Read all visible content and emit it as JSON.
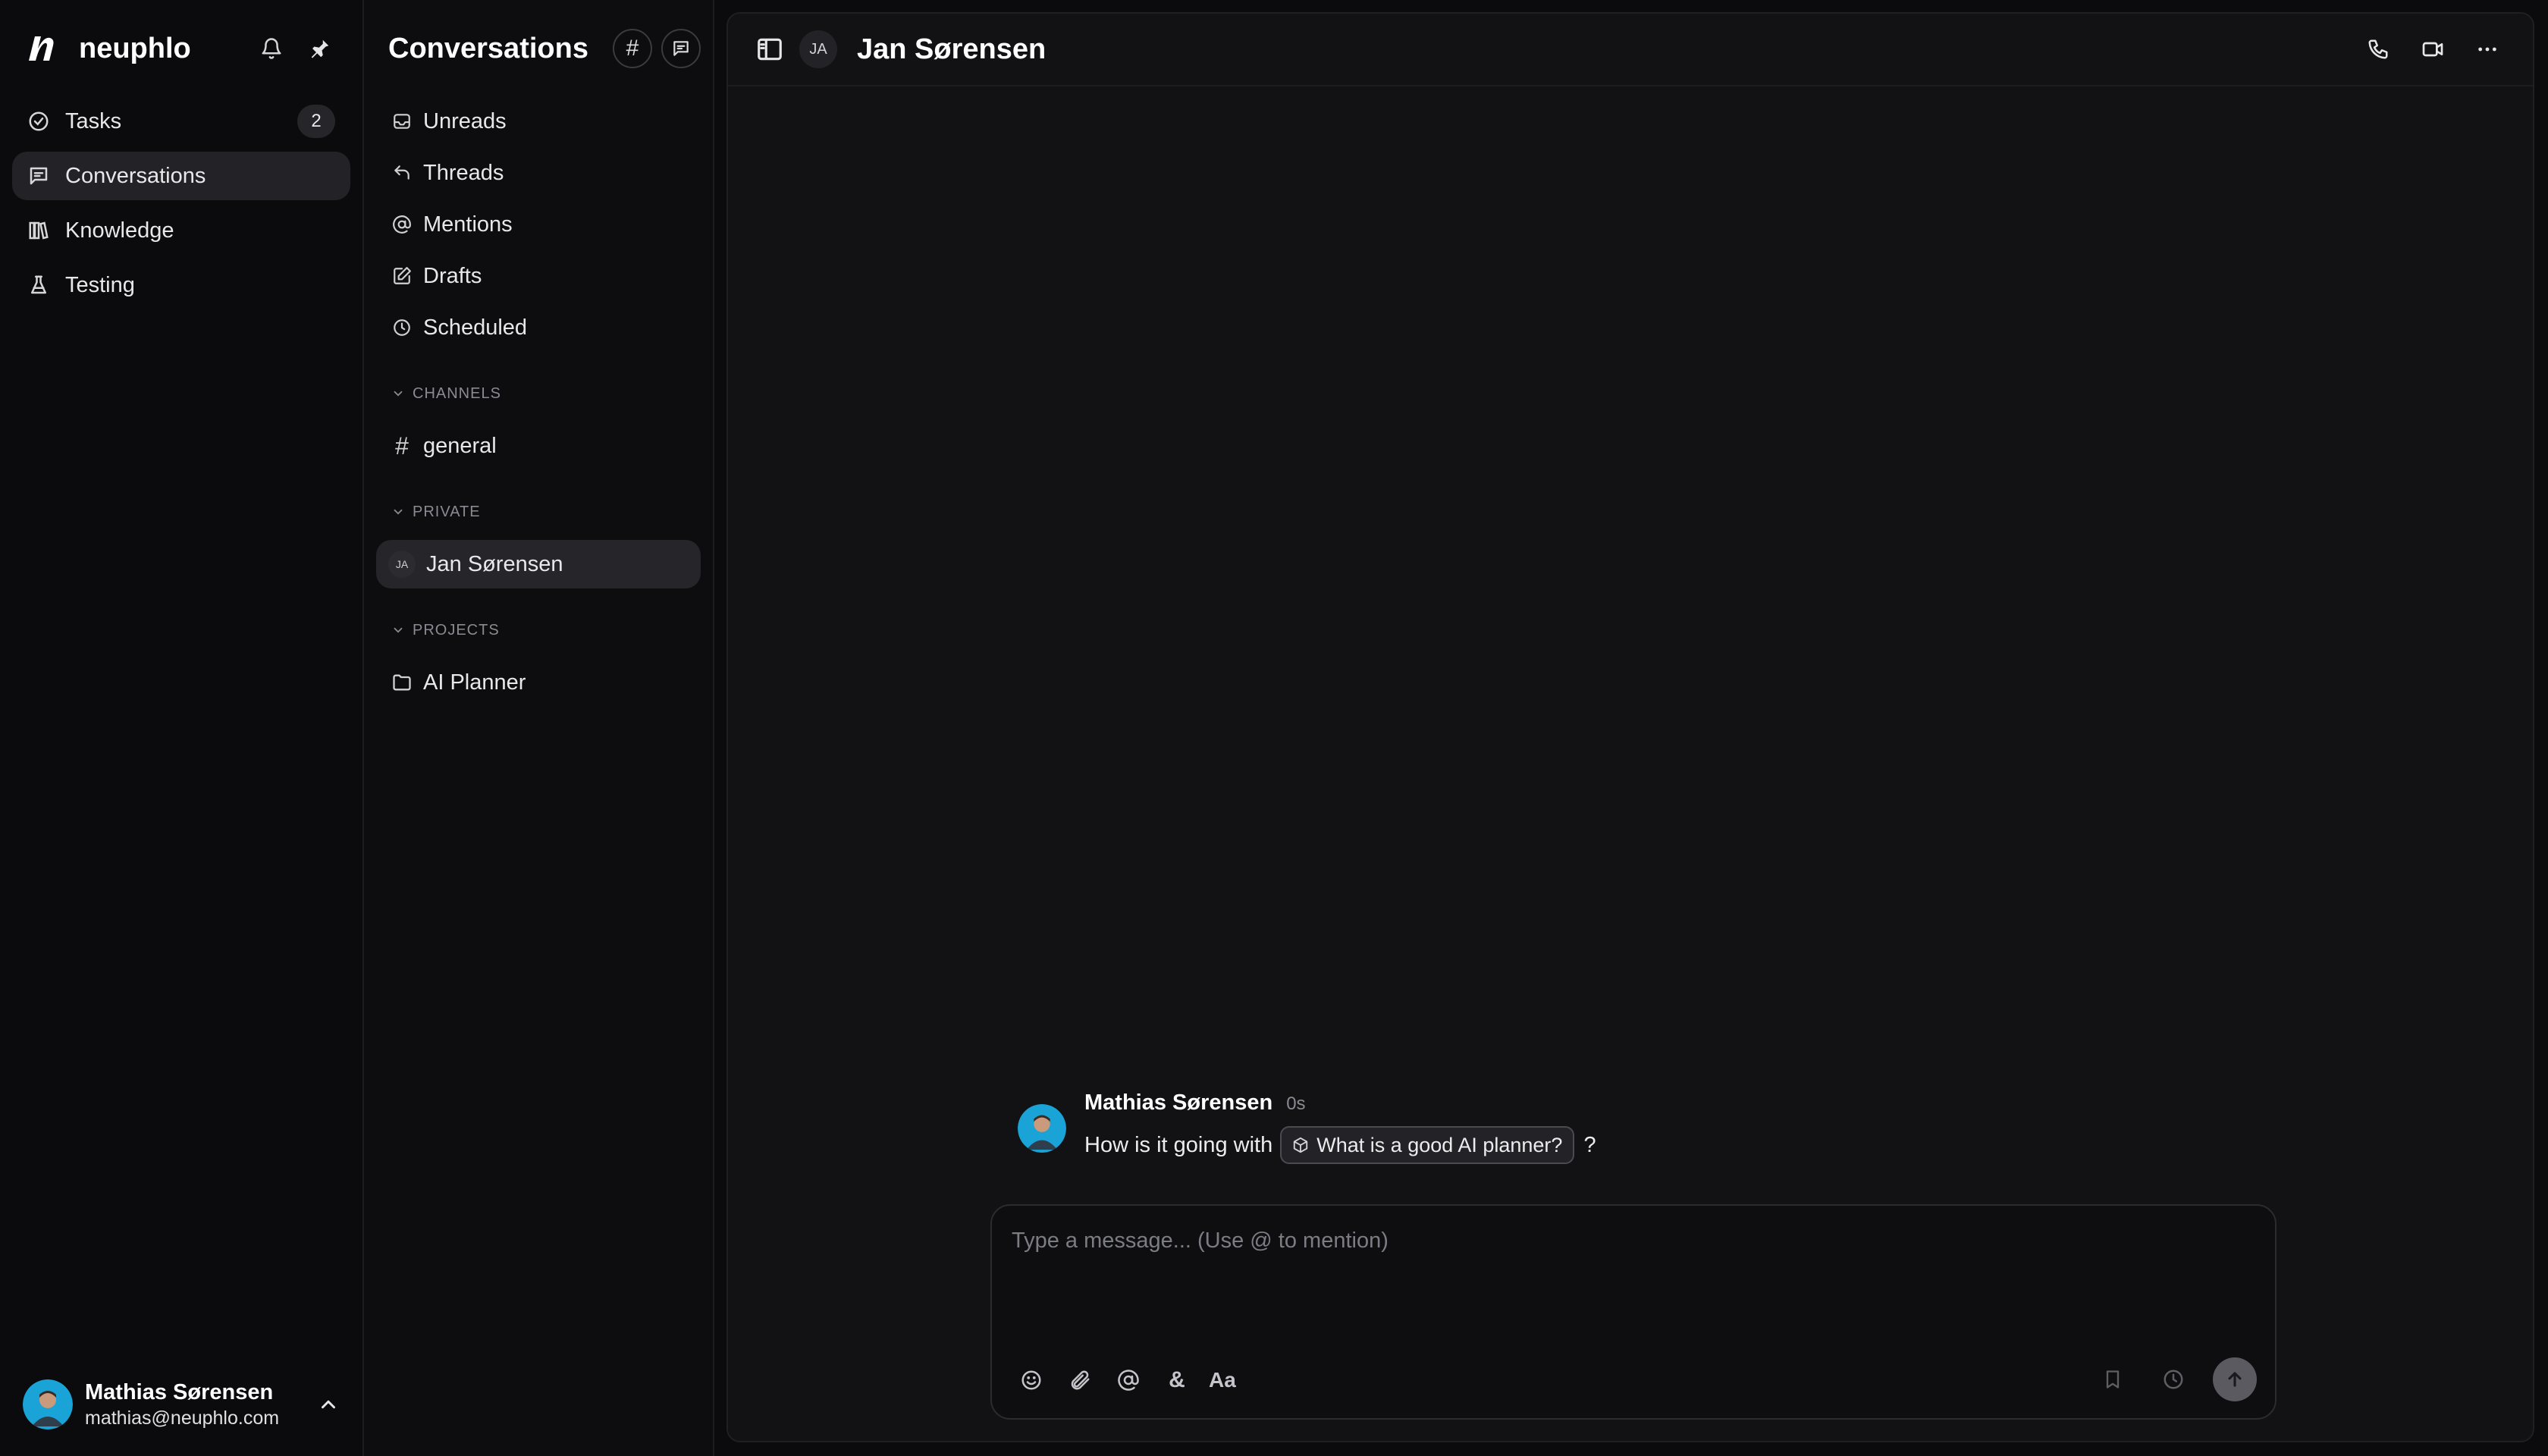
{
  "nav": {
    "brand": "neuphlo",
    "items": [
      {
        "label": "Tasks",
        "badge": "2"
      },
      {
        "label": "Conversations"
      },
      {
        "label": "Knowledge"
      },
      {
        "label": "Testing"
      }
    ],
    "user": {
      "name": "Mathias Sørensen",
      "email": "mathias@neuphlo.com"
    }
  },
  "conversations": {
    "title": "Conversations",
    "inbox": [
      {
        "label": "Unreads"
      },
      {
        "label": "Threads"
      },
      {
        "label": "Mentions"
      },
      {
        "label": "Drafts"
      },
      {
        "label": "Scheduled"
      }
    ],
    "sections": {
      "channels": {
        "label": "CHANNELS",
        "items": [
          {
            "label": "general"
          }
        ]
      },
      "private": {
        "label": "PRIVATE",
        "items": [
          {
            "label": "Jan Sørensen",
            "initials": "JA"
          }
        ]
      },
      "projects": {
        "label": "PROJECTS",
        "items": [
          {
            "label": "AI Planner"
          }
        ]
      }
    }
  },
  "chat": {
    "title": "Jan Sørensen",
    "initials": "JA",
    "message": {
      "author": "Mathias Sørensen",
      "time": "0s",
      "text_before": "How is it going with",
      "chip": "What is a good AI planner?",
      "text_after": "?"
    },
    "composer": {
      "placeholder": "Type a message... (Use @ to mention)",
      "ampersand": "&",
      "format_label": "Aa"
    }
  },
  "colors": {
    "background": "#0b0b0d",
    "panel": "#121215",
    "active": "#232327",
    "send": "#5a5a60",
    "avatar_bg": "#1aa3d6"
  }
}
